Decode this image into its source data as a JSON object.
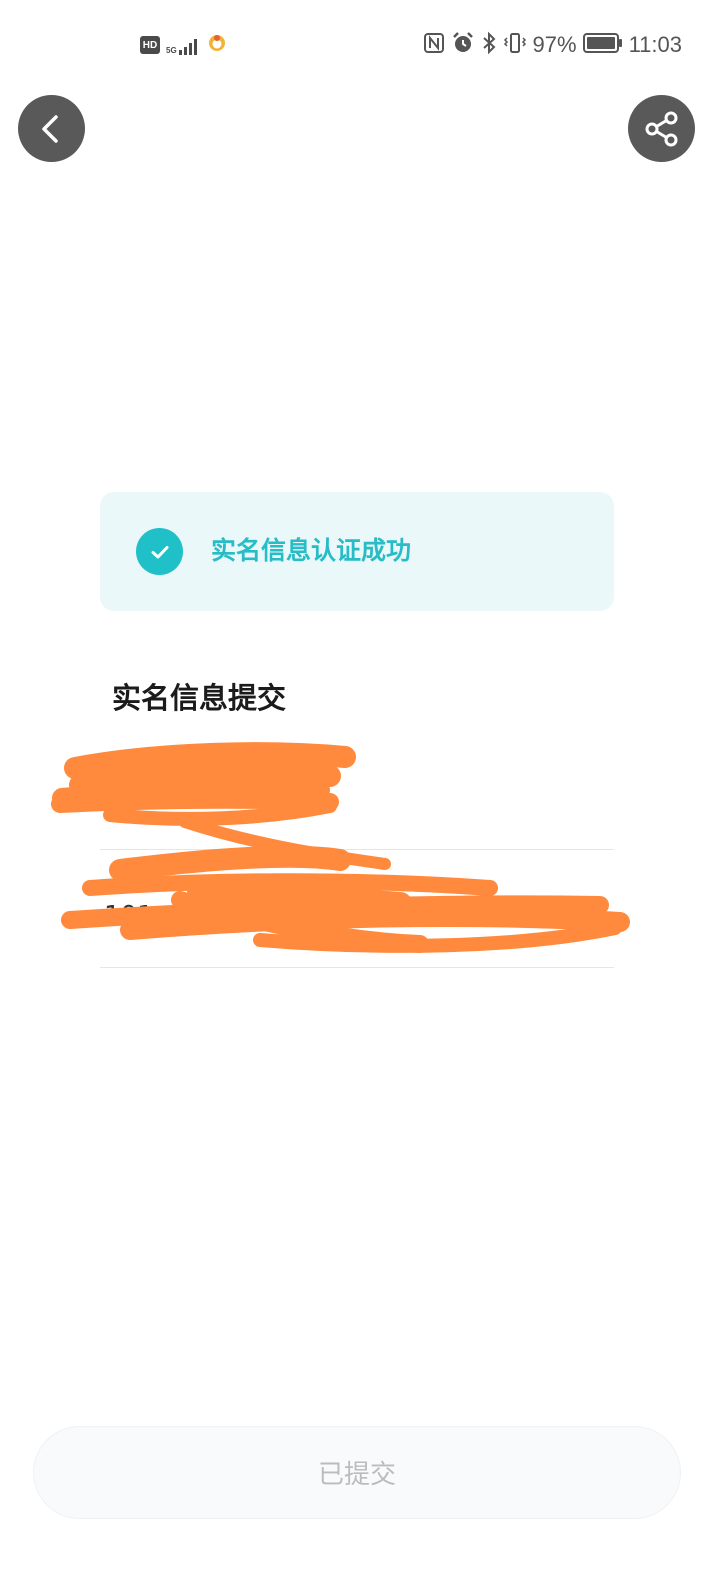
{
  "status_bar": {
    "hd_label": "HD",
    "network_label": "5G",
    "battery_percent": "97%",
    "time": "11:03",
    "icons": [
      "hd-icon",
      "signal-icon",
      "notification-app-icon",
      "nfc-icon",
      "alarm-icon",
      "bluetooth-icon",
      "vibrate-icon",
      "battery-icon"
    ]
  },
  "nav": {
    "back_icon": "chevron-left-icon",
    "share_icon": "share-icon"
  },
  "success_banner": {
    "icon": "check-circle-icon",
    "text": "实名信息认证成功",
    "accent_color": "#1fc0c8"
  },
  "section": {
    "title": "实名信息提交"
  },
  "info_rows": [
    {
      "value": "",
      "redacted": true
    },
    {
      "value": "101",
      "redacted": true
    }
  ],
  "footer": {
    "submit_label": "已提交",
    "disabled": true
  },
  "colors": {
    "redaction": "#ff8a3d",
    "button_bg": "#595959",
    "title": "#1b1b1b"
  }
}
